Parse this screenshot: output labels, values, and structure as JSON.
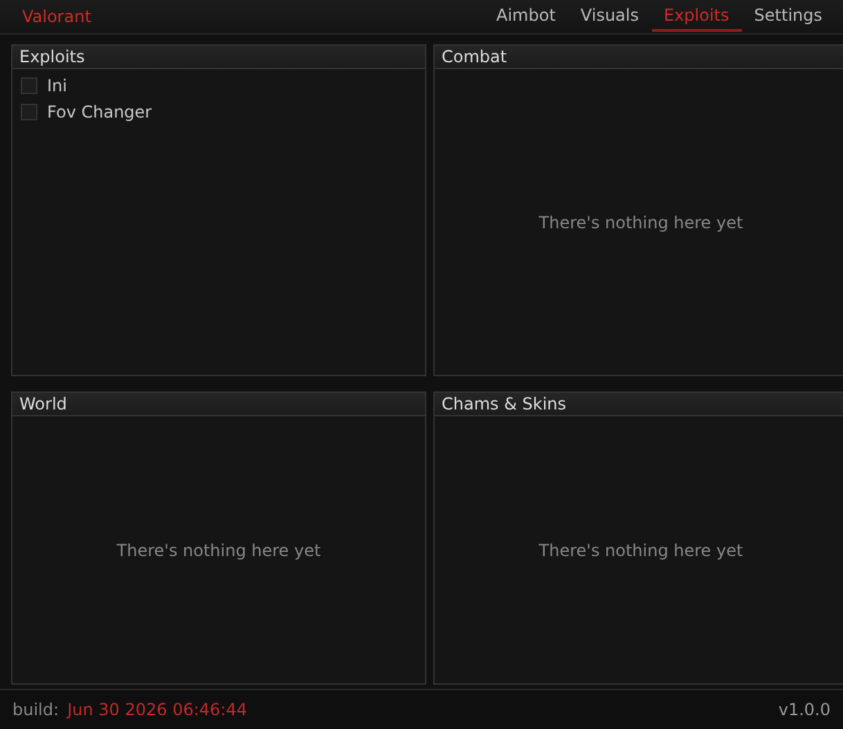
{
  "app_title": "Valorant",
  "tabs": [
    {
      "label": "Aimbot",
      "selected": false
    },
    {
      "label": "Visuals",
      "selected": false
    },
    {
      "label": "Exploits",
      "selected": true
    },
    {
      "label": "Settings",
      "selected": false
    }
  ],
  "panels": [
    {
      "title": "Exploits",
      "items": [
        {
          "label": "Ini",
          "checked": false
        },
        {
          "label": "Fov Changer",
          "checked": false
        }
      ]
    },
    {
      "title": "Combat",
      "empty_text": "There's nothing here yet"
    },
    {
      "title": "World",
      "empty_text": "There's nothing here yet"
    },
    {
      "title": "Chams & Skins",
      "empty_text": "There's nothing here yet"
    }
  ],
  "footer": {
    "build_label": "build:",
    "build_date": "Jun 30 2026 06:46:44",
    "version": "v1.0.0"
  }
}
